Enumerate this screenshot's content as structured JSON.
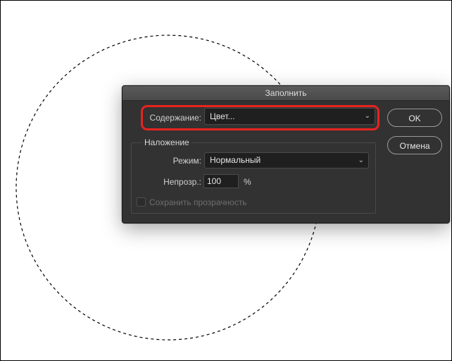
{
  "dialog": {
    "title": "Заполнить",
    "contents_label": "Содержание:",
    "contents_value": "Цвет...",
    "ok_label": "OK",
    "cancel_label": "Отмена",
    "blending": {
      "group_title": "Наложение",
      "mode_label": "Режим:",
      "mode_value": "Нормальный",
      "opacity_label": "Непрозр.:",
      "opacity_value": "100",
      "opacity_unit": "%",
      "preserve_transparency_label": "Сохранить прозрачность",
      "preserve_transparency_checked": false
    }
  },
  "colors": {
    "highlight": "#e8231f",
    "dialog_bg": "#323232",
    "field_bg": "#1f1f1f"
  },
  "icons": {
    "dropdown": "chevron-down-icon"
  }
}
